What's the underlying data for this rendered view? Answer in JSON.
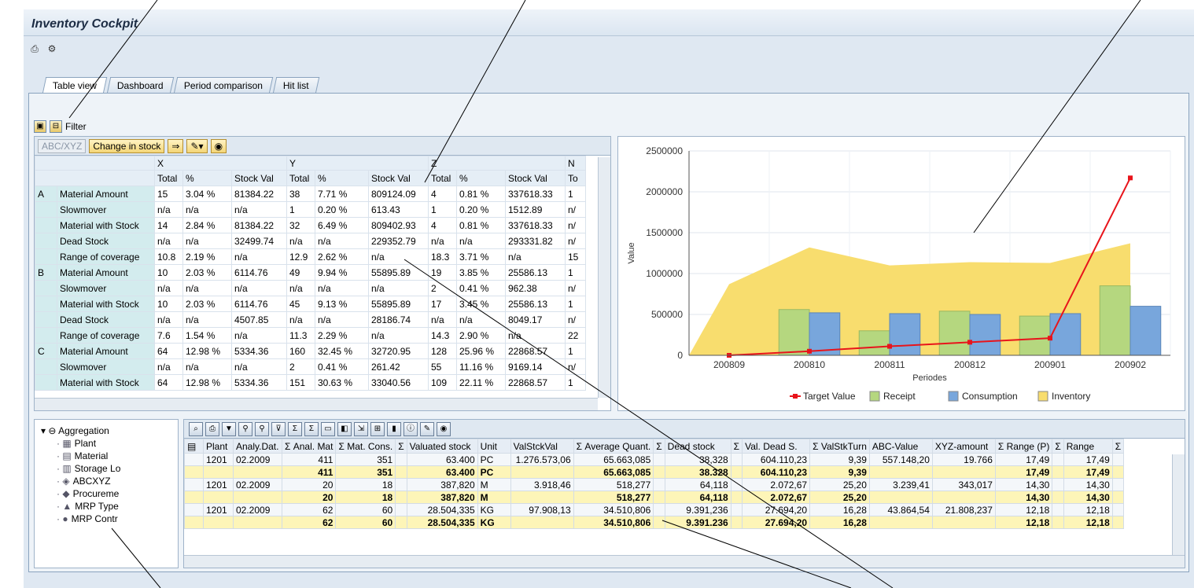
{
  "app": {
    "title": "Inventory Cockpit"
  },
  "toolbar": {
    "icons": [
      "print-icon",
      "settings-icon"
    ]
  },
  "tabs": [
    {
      "label": "Table view",
      "active": true
    },
    {
      "label": "Dashboard",
      "active": false
    },
    {
      "label": "Period comparison",
      "active": false
    },
    {
      "label": "Hit list",
      "active": false
    }
  ],
  "filter": {
    "label": "Filter"
  },
  "table_toolbar": {
    "abc_xyz": "ABC/XYZ",
    "change_in_stock": "Change in stock"
  },
  "matrix": {
    "groups": [
      "X",
      "Y",
      "Z",
      "N"
    ],
    "subheaders": [
      "Total",
      "%",
      "Stock Val",
      "Total",
      "%",
      "Stock Val",
      "Total",
      "%",
      "Stock Val",
      "To"
    ],
    "rows": [
      {
        "g": "A",
        "label": "Material Amount",
        "cells": [
          "15",
          "3.04 %",
          "81384.22",
          "38",
          "7.71 %",
          "809124.09",
          "4",
          "0.81 %",
          "337618.33",
          "1"
        ]
      },
      {
        "g": "",
        "label": "Slowmover",
        "cells": [
          "n/a",
          "n/a",
          "n/a",
          "1",
          "0.20 %",
          "613.43",
          "1",
          "0.20 %",
          "1512.89",
          "n/"
        ]
      },
      {
        "g": "",
        "label": "Material with Stock",
        "cells": [
          "14",
          "2.84 %",
          "81384.22",
          "32",
          "6.49 %",
          "809402.93",
          "4",
          "0.81 %",
          "337618.33",
          "n/"
        ]
      },
      {
        "g": "",
        "label": "Dead Stock",
        "cells": [
          "n/a",
          "n/a",
          "32499.74",
          "n/a",
          "n/a",
          "229352.79",
          "n/a",
          "n/a",
          "293331.82",
          "n/"
        ]
      },
      {
        "g": "",
        "label": "Range of coverage",
        "cells": [
          "10.8",
          "2.19 %",
          "n/a",
          "12.9",
          "2.62 %",
          "n/a",
          "18.3",
          "3.71 %",
          "n/a",
          "15"
        ]
      },
      {
        "g": "B",
        "label": "Material Amount",
        "cells": [
          "10",
          "2.03 %",
          "6114.76",
          "49",
          "9.94 %",
          "55895.89",
          "19",
          "3.85 %",
          "25586.13",
          "1"
        ]
      },
      {
        "g": "",
        "label": "Slowmover",
        "cells": [
          "n/a",
          "n/a",
          "n/a",
          "n/a",
          "n/a",
          "n/a",
          "2",
          "0.41 %",
          "962.38",
          "n/"
        ]
      },
      {
        "g": "",
        "label": "Material with Stock",
        "cells": [
          "10",
          "2.03 %",
          "6114.76",
          "45",
          "9.13 %",
          "55895.89",
          "17",
          "3.45 %",
          "25586.13",
          "1"
        ]
      },
      {
        "g": "",
        "label": "Dead Stock",
        "cells": [
          "n/a",
          "n/a",
          "4507.85",
          "n/a",
          "n/a",
          "28186.74",
          "n/a",
          "n/a",
          "8049.17",
          "n/"
        ]
      },
      {
        "g": "",
        "label": "Range of coverage",
        "cells": [
          "7.6",
          "1.54 %",
          "n/a",
          "11.3",
          "2.29 %",
          "n/a",
          "14.3",
          "2.90 %",
          "n/a",
          "22"
        ]
      },
      {
        "g": "C",
        "label": "Material Amount",
        "cells": [
          "64",
          "12.98 %",
          "5334.36",
          "160",
          "32.45 %",
          "32720.95",
          "128",
          "25.96 %",
          "22868.57",
          "1"
        ]
      },
      {
        "g": "",
        "label": "Slowmover",
        "cells": [
          "n/a",
          "n/a",
          "n/a",
          "2",
          "0.41 %",
          "261.42",
          "55",
          "11.16 %",
          "9169.14",
          "n/"
        ]
      },
      {
        "g": "",
        "label": "Material with Stock",
        "cells": [
          "64",
          "12.98 %",
          "5334.36",
          "151",
          "30.63 %",
          "33040.56",
          "109",
          "22.11 %",
          "22868.57",
          "1"
        ]
      }
    ]
  },
  "chart_data": {
    "type": "bar",
    "categories": [
      "200809",
      "200810",
      "200811",
      "200812",
      "200901",
      "200902"
    ],
    "xlabel": "Periodes",
    "ylabel": "Value",
    "ylim": [
      0,
      2500000
    ],
    "yticks": [
      "0",
      "500000",
      "1000000",
      "1500000",
      "2000000",
      "2500000"
    ],
    "legend_position": "bottom",
    "series": [
      {
        "name": "Target Value",
        "kind": "line",
        "color": "#e8141b",
        "values": [
          0,
          50000,
          110000,
          160000,
          210000,
          2170000
        ]
      },
      {
        "name": "Receipt",
        "kind": "bar",
        "color": "#b5d77f",
        "values": [
          0,
          560000,
          300000,
          540000,
          480000,
          850000
        ]
      },
      {
        "name": "Consumption",
        "kind": "bar",
        "color": "#78a6dc",
        "values": [
          0,
          520000,
          510000,
          500000,
          510000,
          600000
        ]
      },
      {
        "name": "Inventory",
        "kind": "area",
        "color": "#f8dd6e",
        "values": [
          870000,
          1320000,
          1100000,
          1140000,
          1130000,
          1370000
        ]
      }
    ]
  },
  "nav": {
    "root": "Aggregation",
    "items": [
      {
        "label": "Plant",
        "icon": "plant-icon"
      },
      {
        "label": "Material",
        "icon": "material-icon"
      },
      {
        "label": "Storage Lo",
        "icon": "storage-icon"
      },
      {
        "label": "ABCXYZ",
        "icon": "abcxyz-icon"
      },
      {
        "label": "Procureme",
        "icon": "procurement-icon"
      },
      {
        "label": "MRP Type",
        "icon": "mrp-type-icon"
      },
      {
        "label": "MRP Contr",
        "icon": "mrp-controller-icon"
      }
    ]
  },
  "grid": {
    "headers": [
      "Plant",
      "Analy.Dat.",
      "Σ Anal. Mat",
      "Σ Mat. Cons.",
      "Σ",
      "Valuated stock",
      "Unit",
      "ValStckVal",
      "Σ Average Quant.",
      "Σ",
      "Dead stock",
      "Σ",
      "Val. Dead S.",
      "Σ ValStkTurn",
      "ABC-Value",
      "XYZ-amount",
      "Σ Range (P)",
      "Σ",
      "Range",
      "Σ"
    ],
    "rows": [
      {
        "type": "alt",
        "cells": [
          "1201",
          "02.2009",
          "411",
          "351",
          "",
          "63.400",
          "PC",
          "1.276.573,06",
          "65.663,085",
          "",
          "38,328",
          "",
          "604.110,23",
          "9,39",
          "557.148,20",
          "19.766",
          "17,49",
          "",
          "17,49",
          ""
        ]
      },
      {
        "type": "sum",
        "cells": [
          "",
          "",
          "411",
          "351",
          "",
          "63.400",
          "PC",
          "",
          "65.663,085",
          "",
          "38.328",
          "",
          "604.110,23",
          "9,39",
          "",
          "",
          "17,49",
          "",
          "17,49",
          ""
        ]
      },
      {
        "type": "alt",
        "cells": [
          "1201",
          "02.2009",
          "20",
          "18",
          "",
          "387,820",
          "M",
          "3.918,46",
          "518,277",
          "",
          "64,118",
          "",
          "2.072,67",
          "25,20",
          "3.239,41",
          "343,017",
          "14,30",
          "",
          "14,30",
          ""
        ]
      },
      {
        "type": "sum",
        "cells": [
          "",
          "",
          "20",
          "18",
          "",
          "387,820",
          "M",
          "",
          "518,277",
          "",
          "64,118",
          "",
          "2.072,67",
          "25,20",
          "",
          "",
          "14,30",
          "",
          "14,30",
          ""
        ]
      },
      {
        "type": "alt",
        "cells": [
          "1201",
          "02.2009",
          "62",
          "60",
          "",
          "28.504,335",
          "KG",
          "97.908,13",
          "34.510,806",
          "",
          "9.391,236",
          "",
          "27.694,20",
          "16,28",
          "43.864,54",
          "21.808,237",
          "12,18",
          "",
          "12,18",
          ""
        ]
      },
      {
        "type": "sum",
        "cells": [
          "",
          "",
          "62",
          "60",
          "",
          "28.504,335",
          "KG",
          "",
          "34.510,806",
          "",
          "9.391.236",
          "",
          "27.694,20",
          "16,28",
          "",
          "",
          "12,18",
          "",
          "12,18",
          ""
        ]
      }
    ]
  }
}
